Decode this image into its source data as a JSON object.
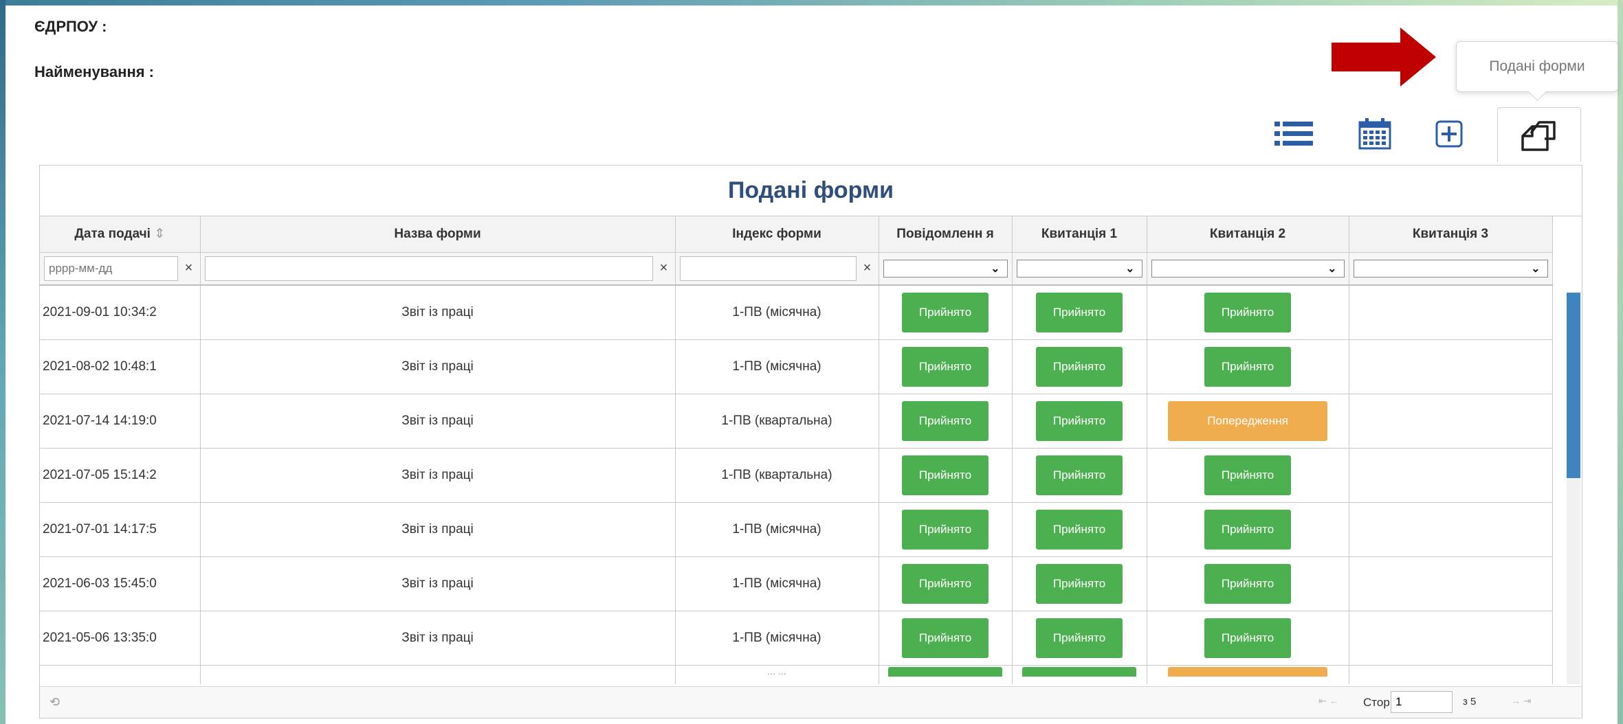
{
  "info": {
    "edrpou_label": "ЄДРПОУ :",
    "name_label": "Найменування :"
  },
  "tooltip": "Подані форми",
  "panel": {
    "title": "Подані форми",
    "columns": [
      "Дата подачі",
      "Назва форми",
      "Індекс форми",
      "Повідомленн я",
      "Квитанція 1",
      "Квитанція 2",
      "Квитанція 3"
    ],
    "sort_icon": "⇕",
    "filters": {
      "date_placeholder": "рррр-мм-дд",
      "clear": "×",
      "select_chevron": "⌄"
    },
    "rows": [
      {
        "date": "2021-09-01 10:34:2",
        "name": "Звіт із праці",
        "index": "1-ПВ (місячна)",
        "msg": "Прийнято",
        "k1": "Прийнято",
        "k2": "Прийнято",
        "k2_type": "green"
      },
      {
        "date": "2021-08-02 10:48:1",
        "name": "Звіт із праці",
        "index": "1-ПВ (місячна)",
        "msg": "Прийнято",
        "k1": "Прийнято",
        "k2": "Прийнято",
        "k2_type": "green"
      },
      {
        "date": "2021-07-14 14:19:0",
        "name": "Звіт із праці",
        "index": "1-ПВ (квартальна)",
        "msg": "Прийнято",
        "k1": "Прийнято",
        "k2": "Попередження",
        "k2_type": "orange"
      },
      {
        "date": "2021-07-05 15:14:2",
        "name": "Звіт із праці",
        "index": "1-ПВ (квартальна)",
        "msg": "Прийнято",
        "k1": "Прийнято",
        "k2": "Прийнято",
        "k2_type": "green"
      },
      {
        "date": "2021-07-01 14:17:5",
        "name": "Звіт із праці",
        "index": "1-ПВ (місячна)",
        "msg": "Прийнято",
        "k1": "Прийнято",
        "k2": "Прийнято",
        "k2_type": "green"
      },
      {
        "date": "2021-06-03 15:45:0",
        "name": "Звіт із праці",
        "index": "1-ПВ (місячна)",
        "msg": "Прийнято",
        "k1": "Прийнято",
        "k2": "Прийнято",
        "k2_type": "green"
      },
      {
        "date": "2021-05-06 13:35:0",
        "name": "Звіт із праці",
        "index": "1-ПВ (місячна)",
        "msg": "Прийнято",
        "k1": "Прийнято",
        "k2": "Прийнято",
        "k2_type": "green"
      }
    ],
    "partial_row_index": "... ..."
  },
  "pager": {
    "refresh_icon": "refresh-icon",
    "refresh_glyph": "⟲",
    "page_label": "Стор.",
    "page_value": "1",
    "of_label": "з 5",
    "nav_first_prev": "⇤ ←",
    "nav_next_last": "→ ⇥"
  },
  "colors": {
    "green": "#4caf50",
    "orange": "#f0ad4e",
    "title": "#2f4f7a",
    "arrow": "#c00000",
    "scroll": "#3f85c2"
  }
}
